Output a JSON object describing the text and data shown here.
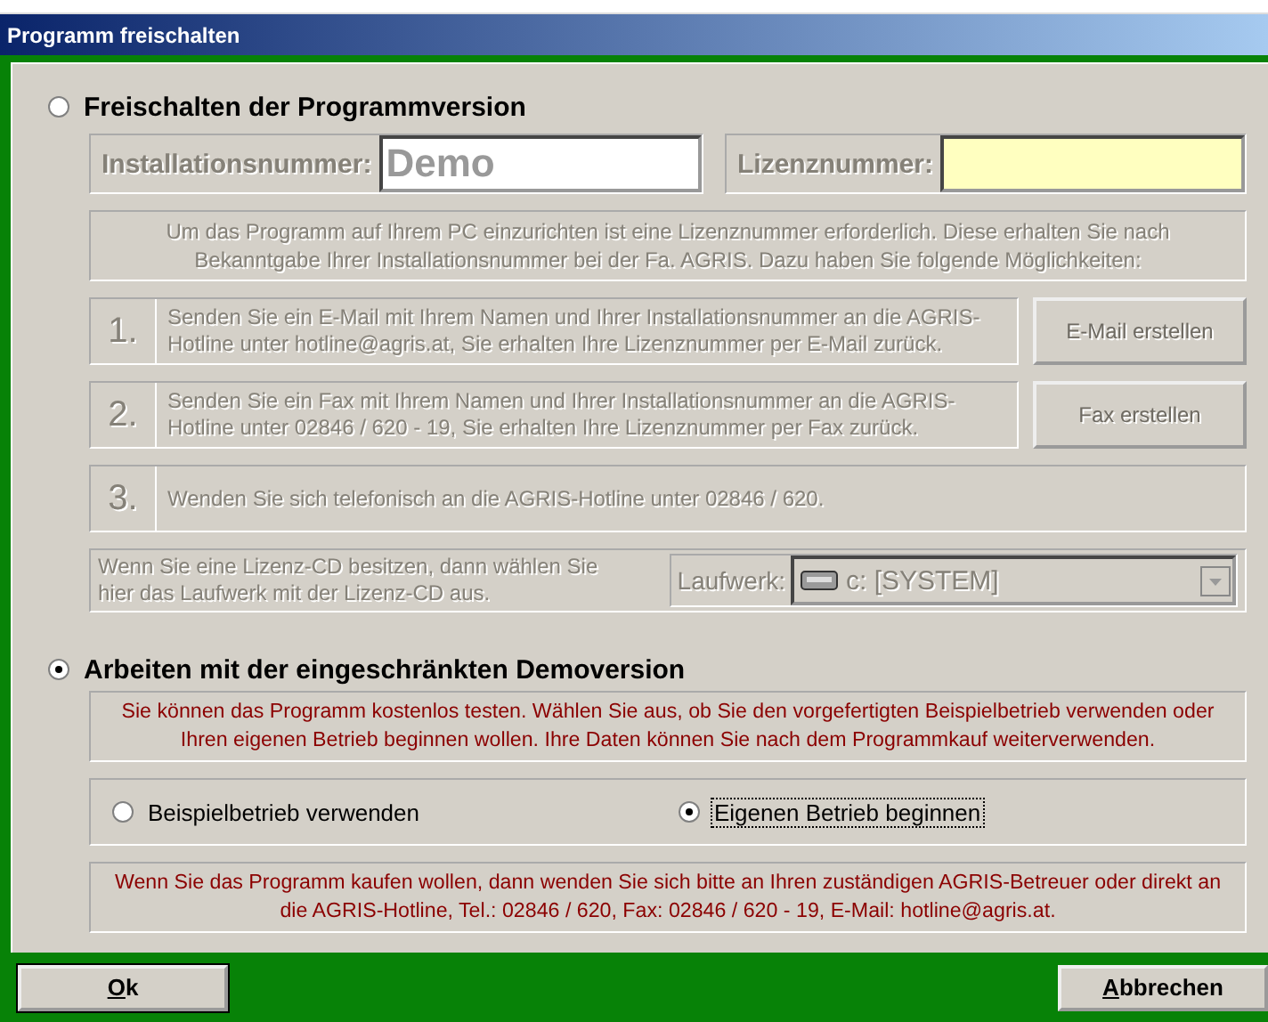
{
  "window": {
    "title": "Programm freischalten"
  },
  "activation": {
    "label": "Freischalten der Programmversion",
    "selected": false,
    "disabled": true,
    "installation_number": {
      "label": "Installationsnummer:",
      "value": "Demo"
    },
    "license_number": {
      "label": "Lizenznummer:"
    },
    "intro": "Um das Programm auf Ihrem PC einzurichten ist eine Lizenznummer erforderlich. Diese erhalten Sie nach Bekanntgabe Ihrer Installationsnummer bei der Fa. AGRIS. Dazu haben Sie folgende Möglichkeiten:",
    "steps": [
      {
        "number": "1.",
        "text": "Senden Sie ein E-Mail mit Ihrem Namen und Ihrer Installationsnummer an die AGRIS-Hotline unter hotline@agris.at, Sie erhalten Ihre Lizenznummer per E-Mail zurück.",
        "button": "E-Mail erstellen"
      },
      {
        "number": "2.",
        "text": "Senden Sie ein Fax mit Ihrem Namen und Ihrer Installationsnummer an die AGRIS-Hotline unter 02846 / 620 - 19, Sie erhalten Ihre Lizenznummer per Fax zurück.",
        "button": "Fax erstellen"
      },
      {
        "number": "3.",
        "text": "Wenden Sie sich telefonisch an die AGRIS-Hotline unter 02846 / 620."
      }
    ],
    "cd": {
      "text": "Wenn Sie eine Lizenz-CD besitzen, dann wählen Sie hier das Laufwerk mit der Lizenz-CD aus.",
      "drive_label": "Laufwerk:",
      "drive": "c: [SYSTEM]"
    }
  },
  "demo": {
    "label": "Arbeiten mit der eingeschränkten Demoversion",
    "selected": true,
    "intro": "Sie können das Programm kostenlos testen. Wählen Sie aus, ob Sie den vorgefertigten Beispielbetrieb verwenden oder Ihren eigenen Betrieb beginnen wollen. Ihre Daten können Sie nach dem Programmkauf weiterverwenden.",
    "options": [
      {
        "label": "Beispielbetrieb verwenden",
        "selected": false,
        "focused": false
      },
      {
        "label": "Eigenen Betrieb beginnen",
        "selected": true,
        "focused": true
      }
    ],
    "notice": "Wenn Sie das Programm kaufen wollen, dann wenden Sie sich bitte an Ihren zuständigen AGRIS-Betreuer oder direkt an die AGRIS-Hotline, Tel.: 02846 / 620, Fax: 02846 / 620 - 19, E-Mail: hotline@agris.at."
  },
  "buttons": [
    {
      "label": "Ok",
      "default": true
    },
    {
      "label": "Abbrechen",
      "default": false
    }
  ]
}
